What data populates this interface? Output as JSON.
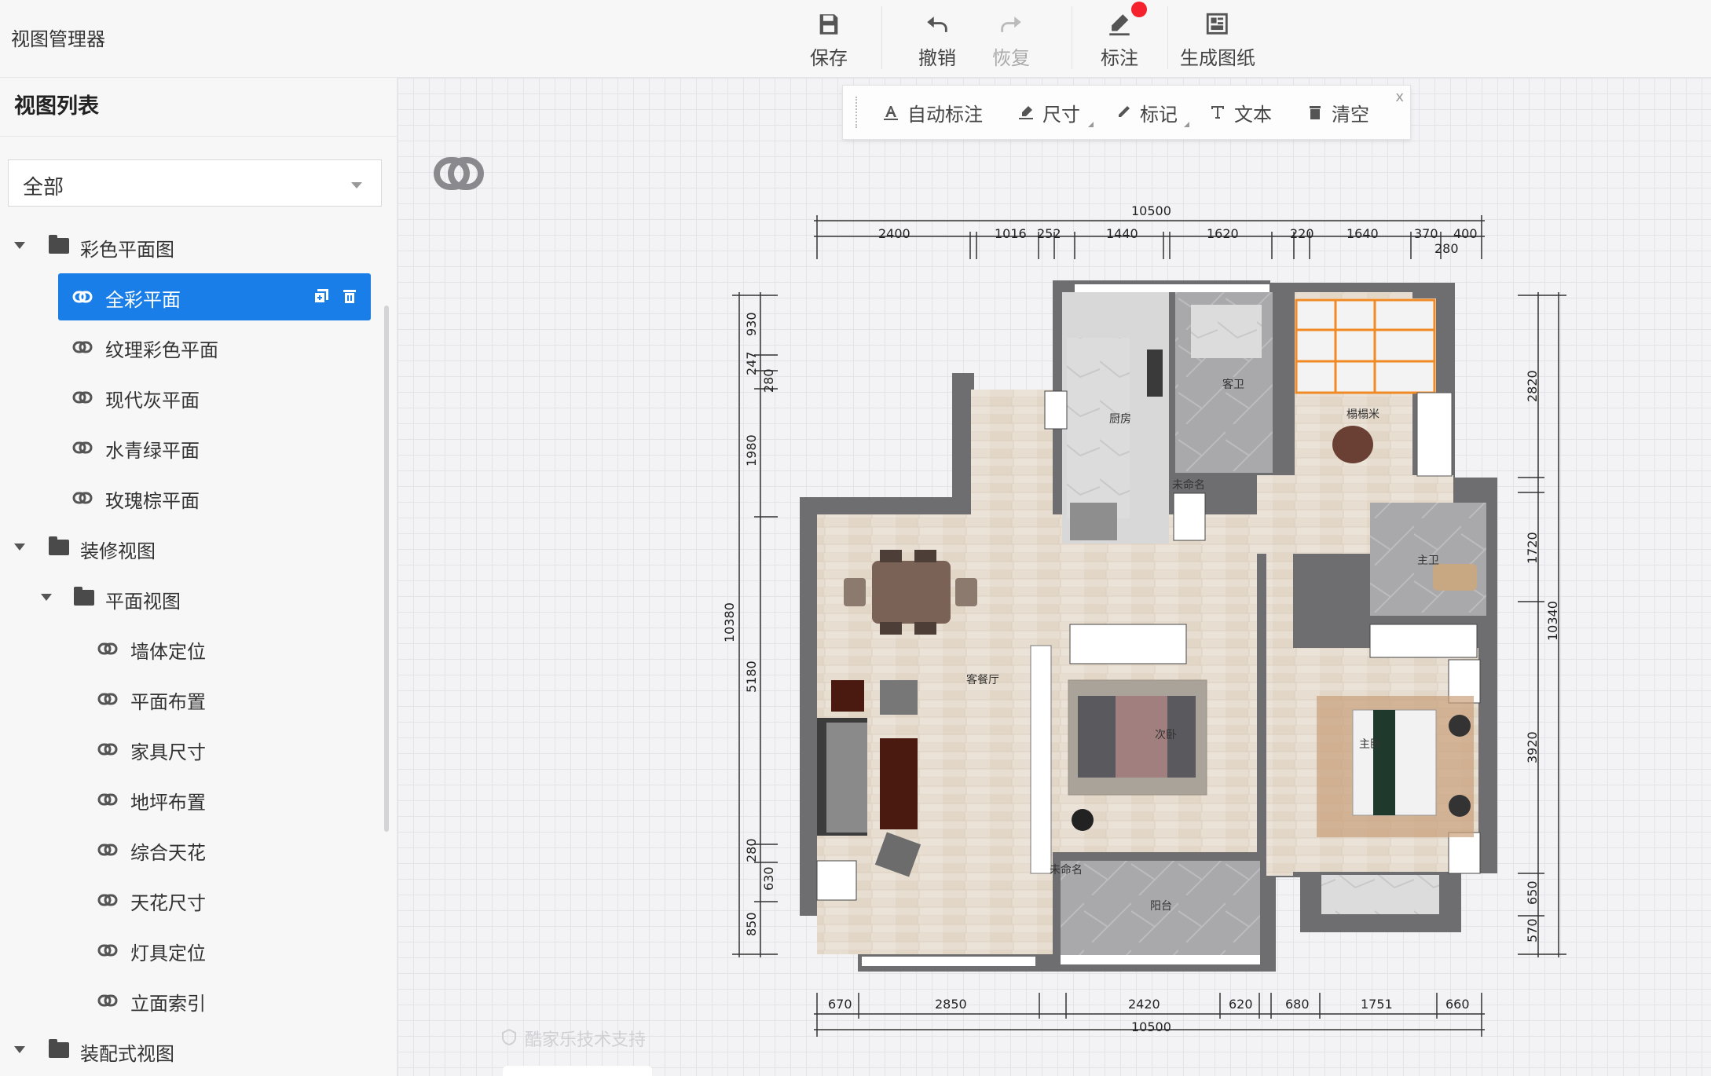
{
  "app": {
    "title": "视图管理器"
  },
  "toolbar": {
    "save_label": "保存",
    "undo_label": "撤销",
    "redo_label": "恢复",
    "annotate_label": "标注",
    "generate_label": "生成图纸"
  },
  "sidebar": {
    "title": "视图列表",
    "filter": {
      "value": "全部"
    },
    "tree": {
      "group_color": "彩色平面图",
      "color_items": [
        "全彩平面",
        "纹理彩色平面",
        "现代灰平面",
        "水青绿平面",
        "玫瑰棕平面"
      ],
      "group_decor": "装修视图",
      "subgroup_plan": "平面视图",
      "plan_items": [
        "墙体定位",
        "平面布置",
        "家具尺寸",
        "地坪布置",
        "综合天花",
        "天花尺寸",
        "灯具定位",
        "立面索引"
      ],
      "group_assembly": "装配式视图"
    }
  },
  "annotation_toolbar": {
    "auto_label": "自动标注",
    "dimension_label": "尺寸",
    "mark_label": "标记",
    "text_label": "文本",
    "clear_label": "清空",
    "close_label": "x"
  },
  "floorplan": {
    "top_total": "10500",
    "top_dims": [
      "2400",
      "1016",
      "252",
      "1440",
      "1620",
      "220",
      "1640",
      "370",
      "400",
      "280"
    ],
    "bottom_total": "10500",
    "bottom_dims": [
      "670",
      "2850",
      "2420",
      "620",
      "680",
      "1751",
      "660"
    ],
    "left_total": "10380",
    "left_dims": [
      "930",
      "247",
      "280",
      "1980",
      "5180",
      "280",
      "630",
      "850"
    ],
    "right_total": "10340",
    "right_dims": [
      "2820",
      "1720",
      "3920",
      "650",
      "570"
    ],
    "rooms": {
      "kitchen": "厨房",
      "guest_bath": "客卫",
      "tatami": "榻榻米",
      "master_bath": "主卫",
      "living_dining": "客餐厅",
      "second_bedroom": "次卧",
      "master_bedroom": "主卧",
      "balcony": "阳台",
      "unnamed_1": "未命名",
      "unnamed_2": "未命名"
    }
  },
  "watermark": "酷家乐技术支持",
  "colors": {
    "accent": "#1a7ee8",
    "badge": "#f5222d",
    "tatami_grid": "#f08a24"
  }
}
